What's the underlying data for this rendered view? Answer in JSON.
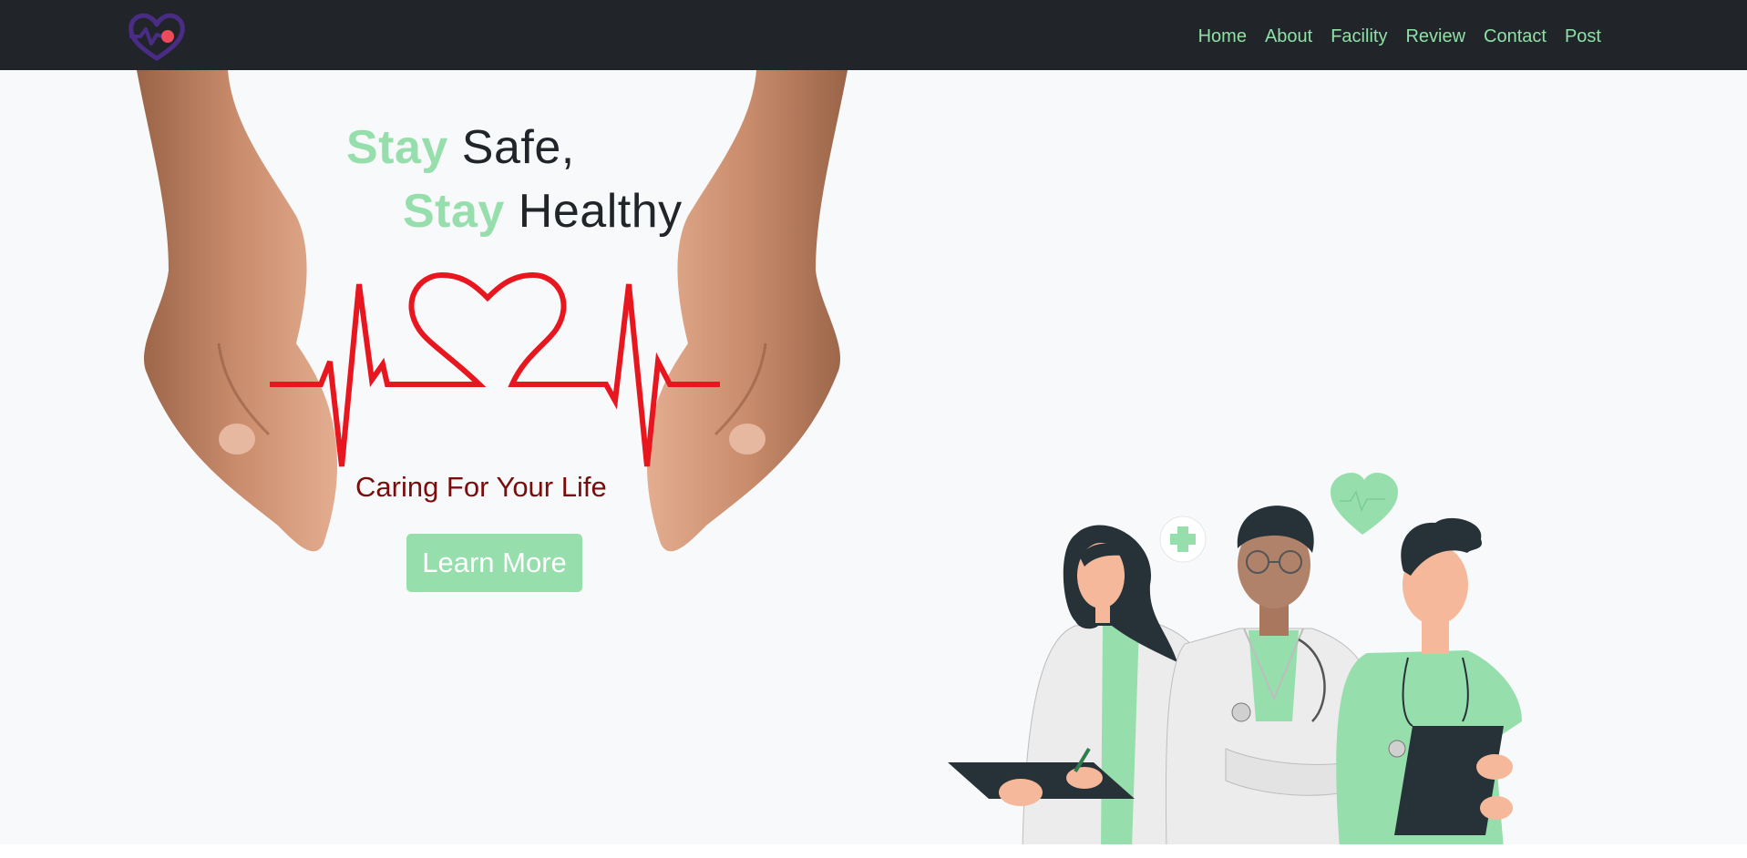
{
  "navbar": {
    "logo_icon": "heart-pulse-icon",
    "links": [
      "Home",
      "About",
      "Facility",
      "Review",
      "Contact",
      "Post"
    ]
  },
  "hero": {
    "line1_accent": "Stay",
    "line1_rest": "Safe,",
    "line2_accent": "Stay",
    "line2_rest": "Healthy",
    "tagline": "Caring For Your Life",
    "button_label": "Learn More"
  },
  "colors": {
    "navbar_bg": "#212529",
    "nav_link": "#8ee0a6",
    "accent_green": "#96dfac",
    "tagline": "#7a0c0c",
    "ekg_red": "#e8161f",
    "hero_bg": "#f8f9fb"
  }
}
